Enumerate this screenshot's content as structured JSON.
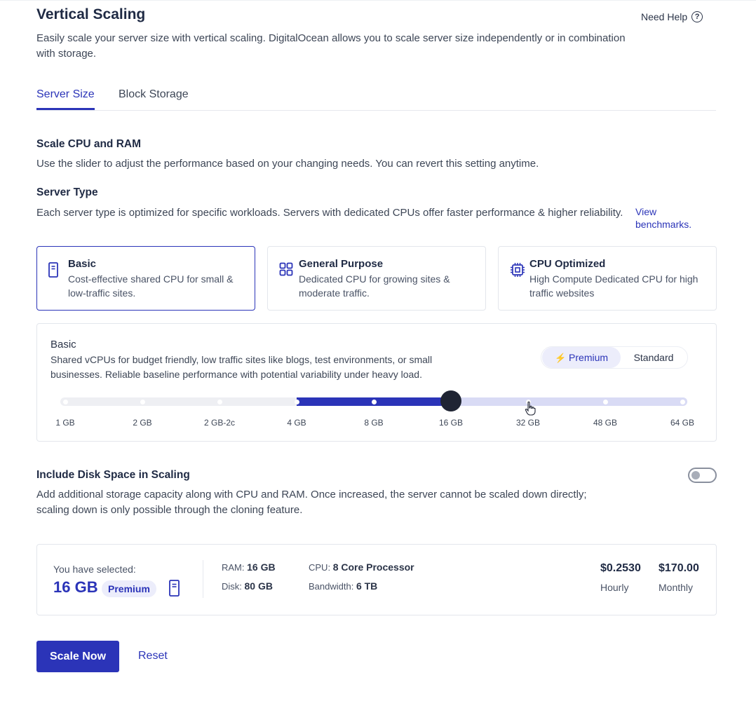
{
  "header": {
    "title": "Vertical Scaling",
    "need_help": "Need Help",
    "description": "Easily scale your server size with vertical scaling. DigitalOcean allows you to scale server size independently or in combination with storage."
  },
  "tabs": [
    {
      "label": "Server Size",
      "active": true
    },
    {
      "label": "Block Storage",
      "active": false
    }
  ],
  "scale": {
    "title": "Scale CPU and RAM",
    "description": "Use the slider to adjust the performance based on your changing needs. You can revert this setting anytime."
  },
  "server_type": {
    "title": "Server Type",
    "description": "Each server type is optimized for specific workloads. Servers with dedicated CPUs offer faster performance & higher reliability.",
    "link": "View benchmarks.",
    "cards": [
      {
        "title": "Basic",
        "description": "Cost-effective shared CPU for small & low-traffic sites.",
        "icon": "server-icon",
        "selected": true
      },
      {
        "title": "General Purpose",
        "description": "Dedicated CPU for growing sites & moderate traffic.",
        "icon": "grid-icon",
        "selected": false
      },
      {
        "title": "CPU Optimized",
        "description": "High Compute Dedicated CPU for high traffic websites",
        "icon": "cpu-chip-icon",
        "selected": false
      }
    ]
  },
  "panel": {
    "title": "Basic",
    "description": "Shared vCPUs for budget friendly, low traffic sites like blogs, test environments, or small businesses. Reliable baseline performance with potential variability under heavy load.",
    "toggle": {
      "premium": "Premium",
      "standard": "Standard",
      "selected": "Premium"
    },
    "slider": {
      "ticks": [
        "1 GB",
        "2 GB",
        "2 GB-2c",
        "4 GB",
        "8 GB",
        "16 GB",
        "32 GB",
        "48 GB",
        "64 GB"
      ],
      "current_index": 5,
      "current_plan_index": 3
    }
  },
  "disk": {
    "title": "Include Disk Space in Scaling",
    "description": "Add additional storage capacity along with CPU and RAM. Once increased, the server cannot be scaled down directly; scaling down is only possible through the cloning feature.",
    "enabled": false
  },
  "summary": {
    "label": "You have selected:",
    "value": "16 GB",
    "badge": "Premium",
    "ram_label": "RAM:",
    "ram_value": "16 GB",
    "disk_label": "Disk:",
    "disk_value": "80 GB",
    "cpu_label": "CPU:",
    "cpu_value": "8 Core Processor",
    "bandwidth_label": "Bandwidth:",
    "bandwidth_value": "6 TB",
    "hourly_price": "$0.2530",
    "hourly_label": "Hourly",
    "monthly_price": "$170.00",
    "monthly_label": "Monthly"
  },
  "actions": {
    "scale_now": "Scale Now",
    "reset": "Reset"
  },
  "colors": {
    "accent": "#2b34b8",
    "accent_light": "#d9dbf5",
    "knob": "#1f2433"
  }
}
